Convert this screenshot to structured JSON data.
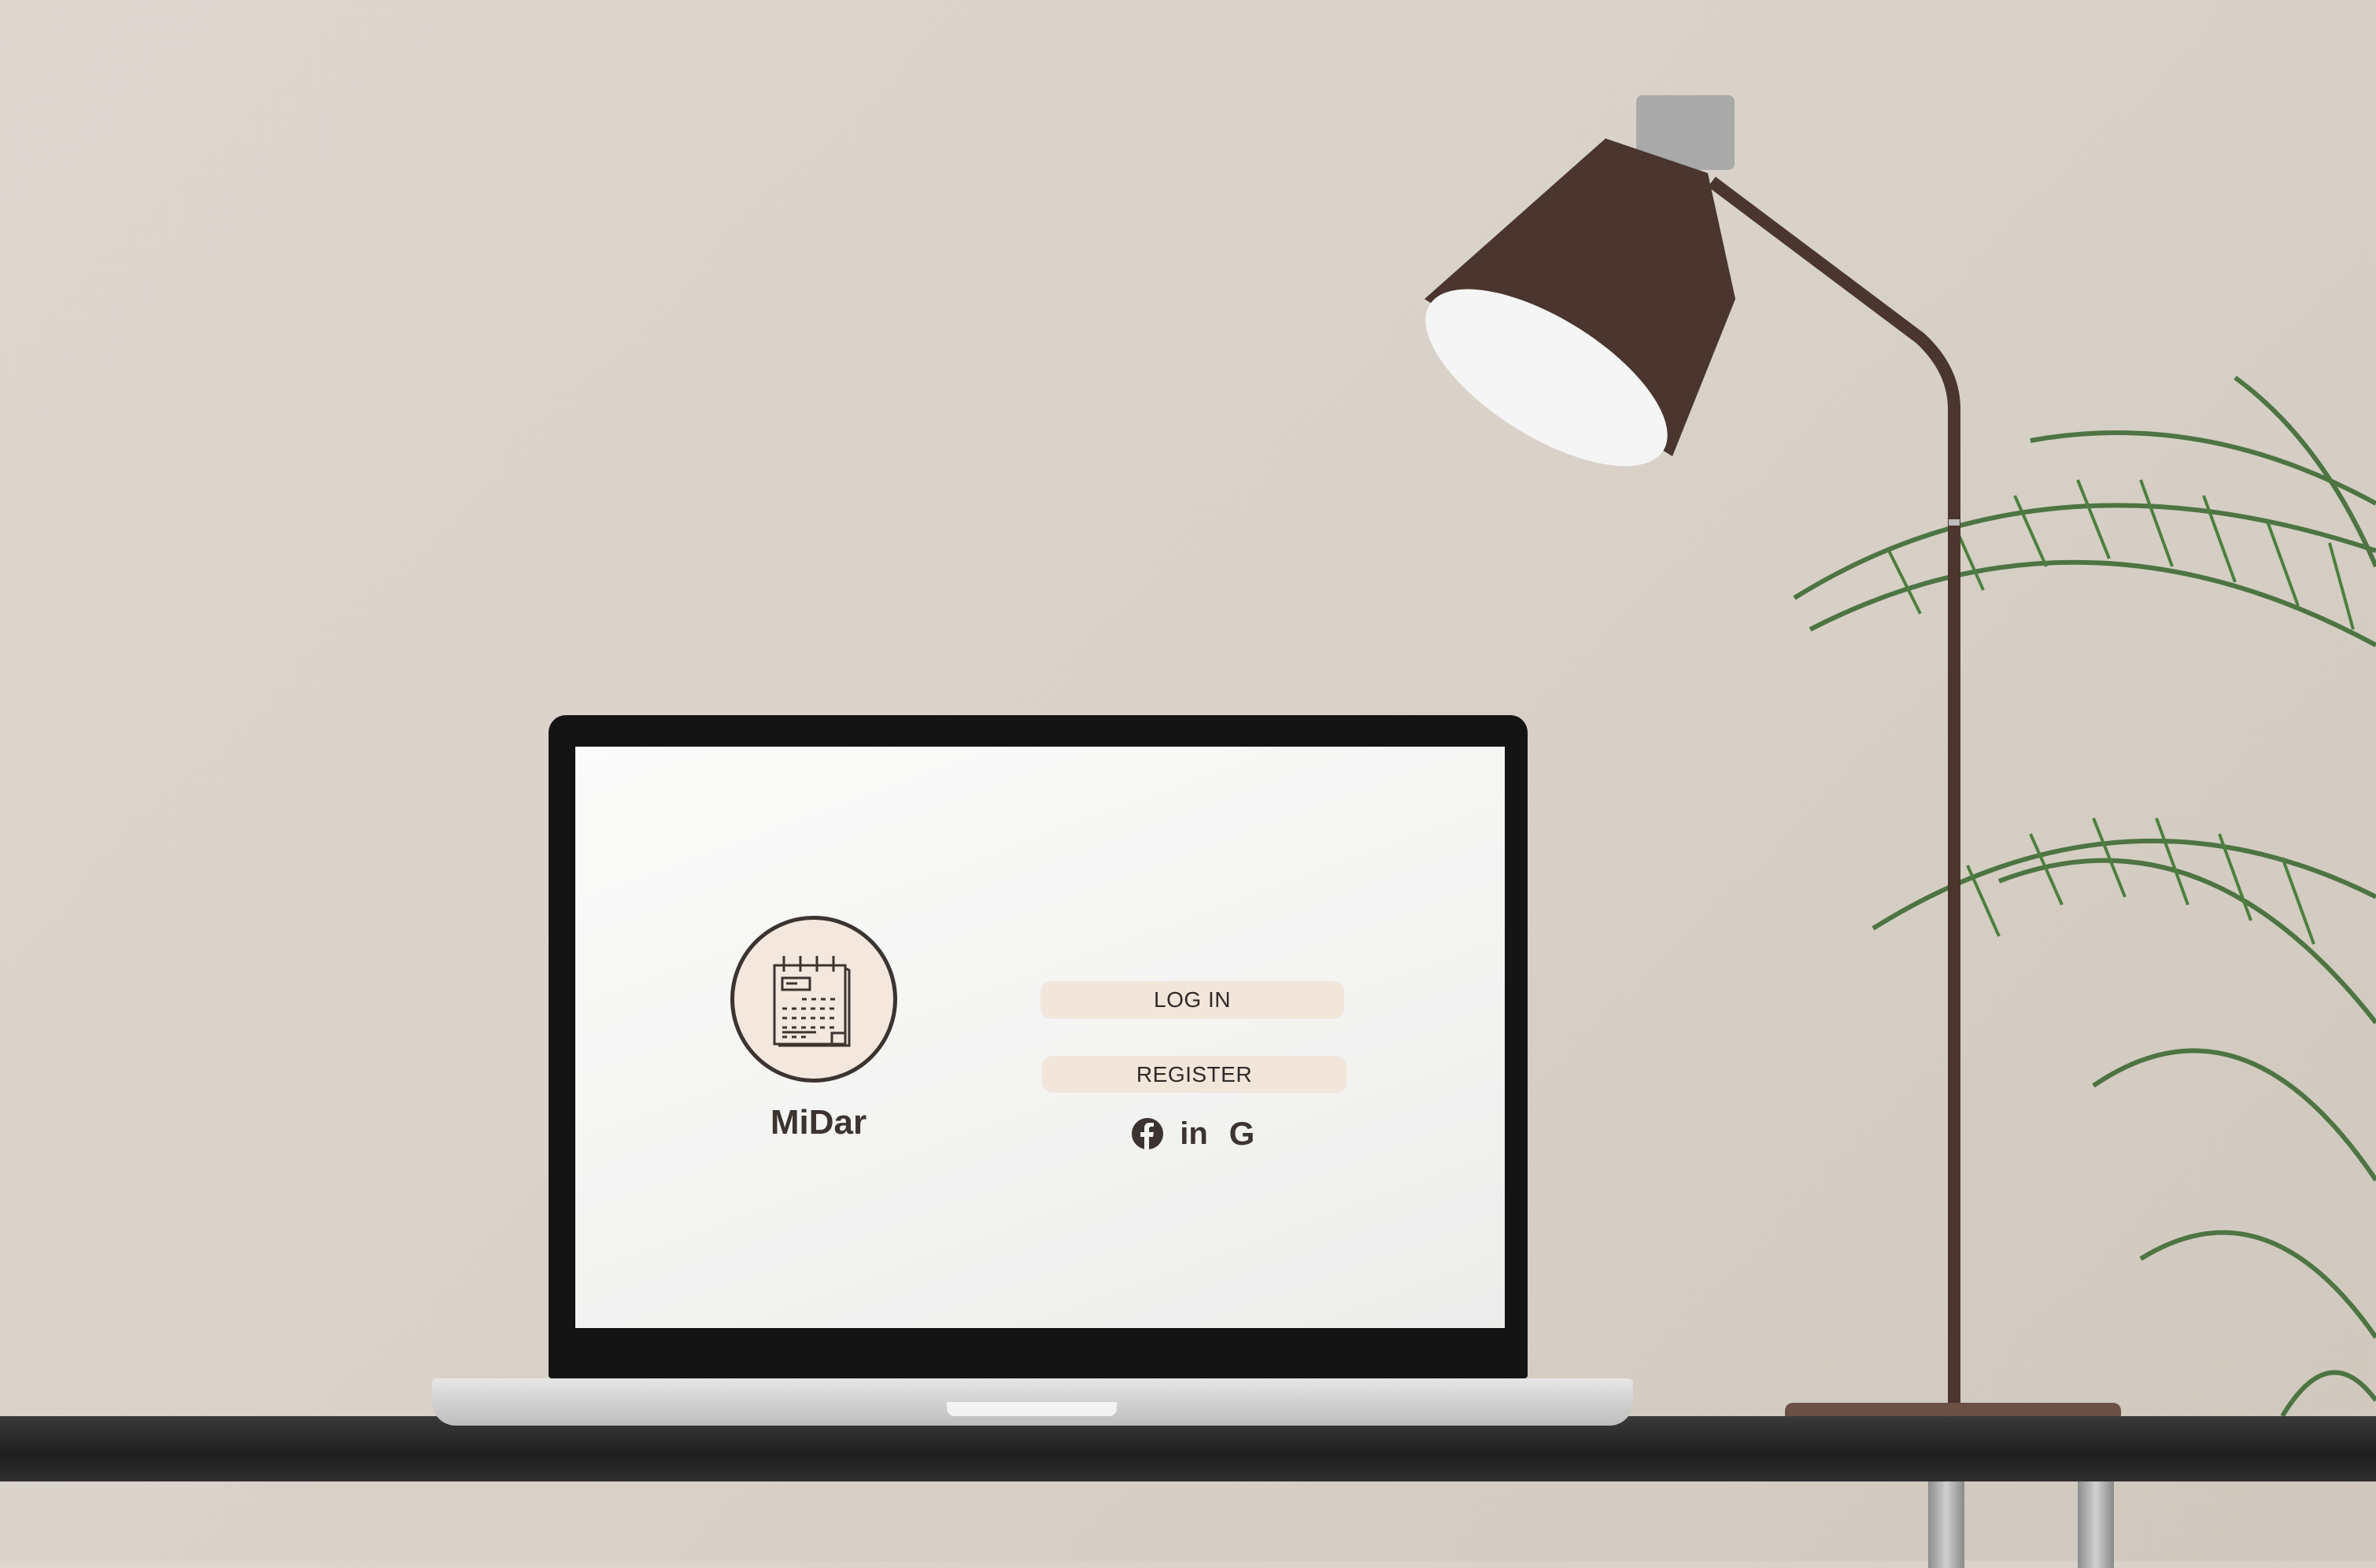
{
  "app": {
    "brand_name": "MiDar",
    "logo_icon": "calendar-notepad-icon",
    "buttons": {
      "login_label": "LOG IN",
      "register_label": "REGISTER"
    },
    "social_logins": [
      {
        "name": "facebook",
        "icon": "facebook-icon"
      },
      {
        "name": "linkedin",
        "icon": "linkedin-icon",
        "glyph": "in"
      },
      {
        "name": "google",
        "icon": "google-icon",
        "glyph": "G"
      }
    ]
  },
  "colors": {
    "accent_button": "#f2e5da",
    "text_dark": "#3b3430",
    "lamp_brown": "#4a362e"
  }
}
